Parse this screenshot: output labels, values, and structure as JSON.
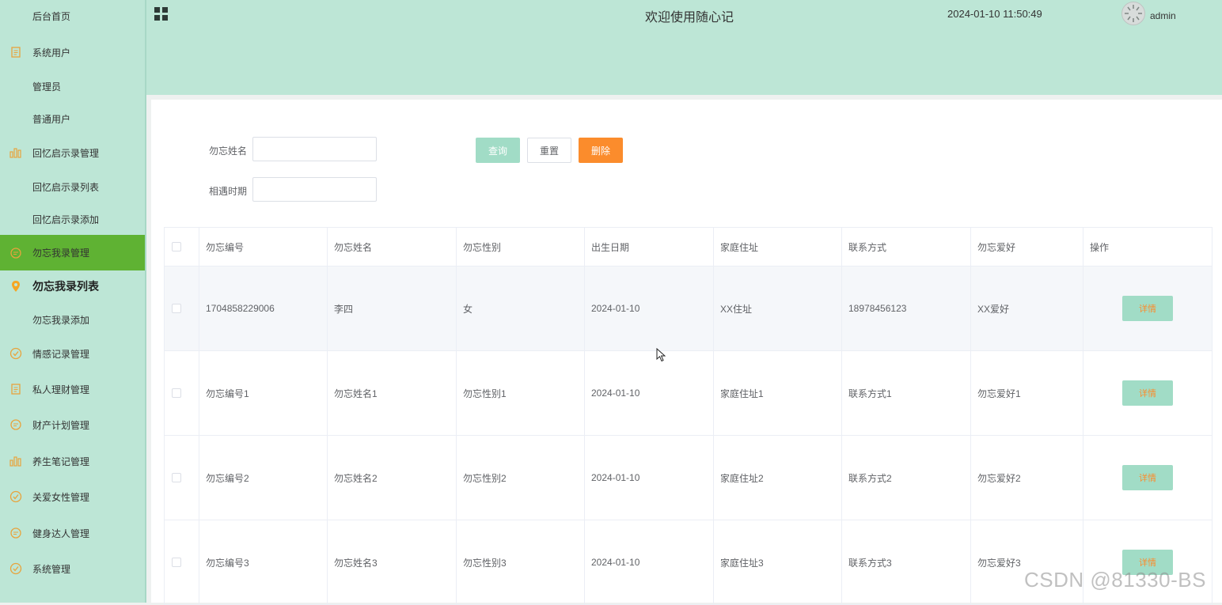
{
  "sidebar": {
    "items": [
      {
        "label": "后台首页",
        "icon": "none"
      },
      {
        "label": "系统用户",
        "icon": "document-icon"
      },
      {
        "label": "管理员",
        "icon": "none"
      },
      {
        "label": "普通用户",
        "icon": "none"
      },
      {
        "label": "回忆启示录管理",
        "icon": "bar-chart-icon"
      },
      {
        "label": "回忆启示录列表",
        "icon": "none"
      },
      {
        "label": "回忆启示录添加",
        "icon": "none"
      },
      {
        "label": "勿忘我录管理",
        "icon": "chat-icon"
      },
      {
        "label": "勿忘我录列表",
        "icon": "location-pin-icon"
      },
      {
        "label": "勿忘我录添加",
        "icon": "none"
      },
      {
        "label": "情感记录管理",
        "icon": "check-circle-icon"
      },
      {
        "label": "私人理财管理",
        "icon": "document-icon"
      },
      {
        "label": "财产计划管理",
        "icon": "chat-icon"
      },
      {
        "label": "养生笔记管理",
        "icon": "bar-chart-icon"
      },
      {
        "label": "关爱女性管理",
        "icon": "check-circle-icon"
      },
      {
        "label": "健身达人管理",
        "icon": "chat-icon"
      },
      {
        "label": "系统管理",
        "icon": "check-circle-icon"
      }
    ]
  },
  "header": {
    "title": "欢迎使用随心记",
    "datetime": "2024-01-10 11:50:49",
    "username": "admin"
  },
  "search": {
    "name_label": "勿忘姓名",
    "name_value": "",
    "date_label": "相遇时期",
    "date_value": "",
    "query_button": "查询",
    "reset_button": "重置",
    "delete_button": "删除"
  },
  "table": {
    "columns": [
      "勿忘编号",
      "勿忘姓名",
      "勿忘性别",
      "出生日期",
      "家庭住址",
      "联系方式",
      "勿忘爱好",
      "操作"
    ],
    "rows": [
      [
        "1704858229006",
        "李四",
        "女",
        "2024-01-10",
        "XX住址",
        "18978456123",
        "XX爱好"
      ],
      [
        "勿忘编号1",
        "勿忘姓名1",
        "勿忘性别1",
        "2024-01-10",
        "家庭住址1",
        "联系方式1",
        "勿忘爱好1"
      ],
      [
        "勿忘编号2",
        "勿忘姓名2",
        "勿忘性别2",
        "2024-01-10",
        "家庭住址2",
        "联系方式2",
        "勿忘爱好2"
      ],
      [
        "勿忘编号3",
        "勿忘姓名3",
        "勿忘性别3",
        "2024-01-10",
        "家庭住址3",
        "联系方式3",
        "勿忘爱好3"
      ]
    ],
    "detail_button": "详情"
  },
  "watermark": "CSDN @81330-BS",
  "colors": {
    "theme": "#bde6d6",
    "active_menu": "#5fb233",
    "accent_orange": "#fb8c2c",
    "button_green": "#a1dcc6"
  }
}
